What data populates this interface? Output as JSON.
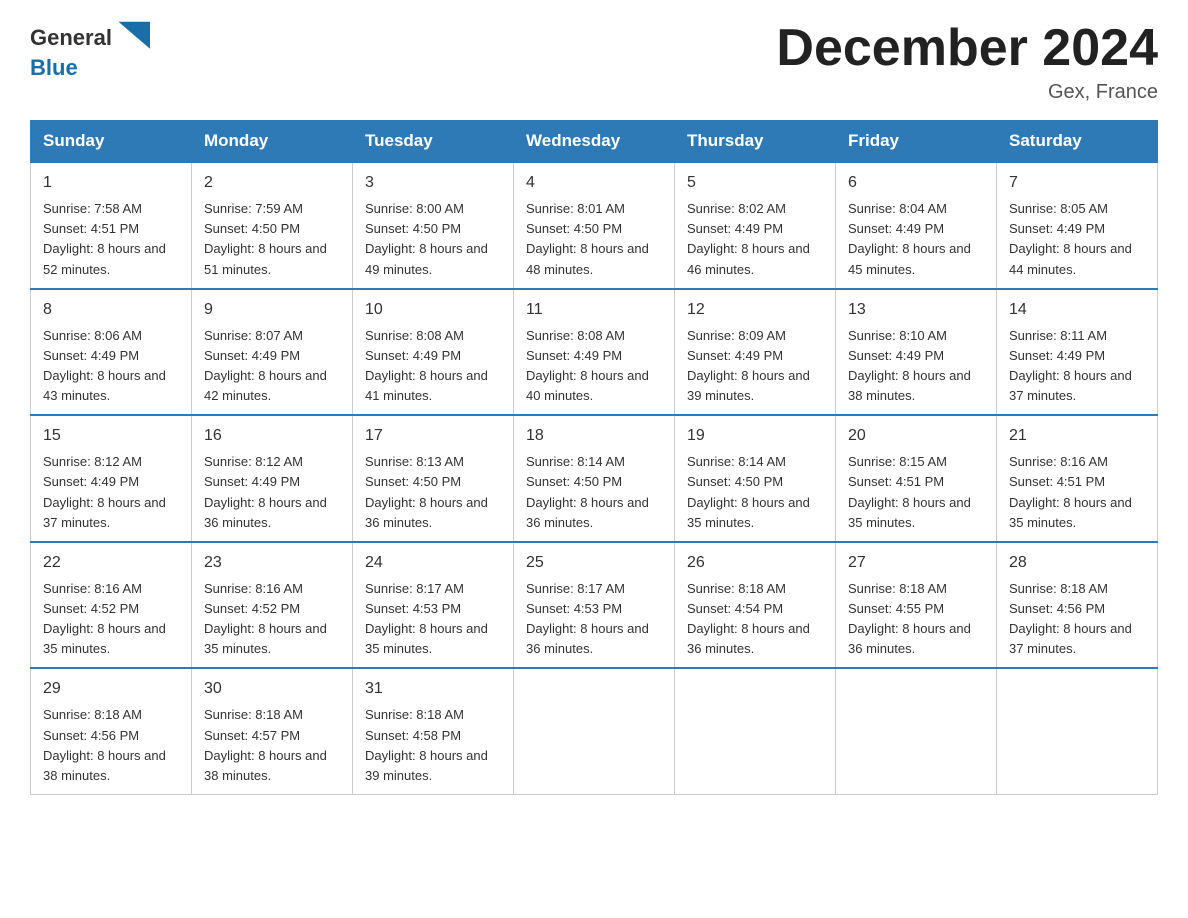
{
  "logo": {
    "text_general": "General",
    "text_blue": "Blue"
  },
  "header": {
    "month_title": "December 2024",
    "location": "Gex, France"
  },
  "weekdays": [
    "Sunday",
    "Monday",
    "Tuesday",
    "Wednesday",
    "Thursday",
    "Friday",
    "Saturday"
  ],
  "weeks": [
    [
      {
        "day": "1",
        "sunrise": "7:58 AM",
        "sunset": "4:51 PM",
        "daylight": "8 hours and 52 minutes."
      },
      {
        "day": "2",
        "sunrise": "7:59 AM",
        "sunset": "4:50 PM",
        "daylight": "8 hours and 51 minutes."
      },
      {
        "day": "3",
        "sunrise": "8:00 AM",
        "sunset": "4:50 PM",
        "daylight": "8 hours and 49 minutes."
      },
      {
        "day": "4",
        "sunrise": "8:01 AM",
        "sunset": "4:50 PM",
        "daylight": "8 hours and 48 minutes."
      },
      {
        "day": "5",
        "sunrise": "8:02 AM",
        "sunset": "4:49 PM",
        "daylight": "8 hours and 46 minutes."
      },
      {
        "day": "6",
        "sunrise": "8:04 AM",
        "sunset": "4:49 PM",
        "daylight": "8 hours and 45 minutes."
      },
      {
        "day": "7",
        "sunrise": "8:05 AM",
        "sunset": "4:49 PM",
        "daylight": "8 hours and 44 minutes."
      }
    ],
    [
      {
        "day": "8",
        "sunrise": "8:06 AM",
        "sunset": "4:49 PM",
        "daylight": "8 hours and 43 minutes."
      },
      {
        "day": "9",
        "sunrise": "8:07 AM",
        "sunset": "4:49 PM",
        "daylight": "8 hours and 42 minutes."
      },
      {
        "day": "10",
        "sunrise": "8:08 AM",
        "sunset": "4:49 PM",
        "daylight": "8 hours and 41 minutes."
      },
      {
        "day": "11",
        "sunrise": "8:08 AM",
        "sunset": "4:49 PM",
        "daylight": "8 hours and 40 minutes."
      },
      {
        "day": "12",
        "sunrise": "8:09 AM",
        "sunset": "4:49 PM",
        "daylight": "8 hours and 39 minutes."
      },
      {
        "day": "13",
        "sunrise": "8:10 AM",
        "sunset": "4:49 PM",
        "daylight": "8 hours and 38 minutes."
      },
      {
        "day": "14",
        "sunrise": "8:11 AM",
        "sunset": "4:49 PM",
        "daylight": "8 hours and 37 minutes."
      }
    ],
    [
      {
        "day": "15",
        "sunrise": "8:12 AM",
        "sunset": "4:49 PM",
        "daylight": "8 hours and 37 minutes."
      },
      {
        "day": "16",
        "sunrise": "8:12 AM",
        "sunset": "4:49 PM",
        "daylight": "8 hours and 36 minutes."
      },
      {
        "day": "17",
        "sunrise": "8:13 AM",
        "sunset": "4:50 PM",
        "daylight": "8 hours and 36 minutes."
      },
      {
        "day": "18",
        "sunrise": "8:14 AM",
        "sunset": "4:50 PM",
        "daylight": "8 hours and 36 minutes."
      },
      {
        "day": "19",
        "sunrise": "8:14 AM",
        "sunset": "4:50 PM",
        "daylight": "8 hours and 35 minutes."
      },
      {
        "day": "20",
        "sunrise": "8:15 AM",
        "sunset": "4:51 PM",
        "daylight": "8 hours and 35 minutes."
      },
      {
        "day": "21",
        "sunrise": "8:16 AM",
        "sunset": "4:51 PM",
        "daylight": "8 hours and 35 minutes."
      }
    ],
    [
      {
        "day": "22",
        "sunrise": "8:16 AM",
        "sunset": "4:52 PM",
        "daylight": "8 hours and 35 minutes."
      },
      {
        "day": "23",
        "sunrise": "8:16 AM",
        "sunset": "4:52 PM",
        "daylight": "8 hours and 35 minutes."
      },
      {
        "day": "24",
        "sunrise": "8:17 AM",
        "sunset": "4:53 PM",
        "daylight": "8 hours and 35 minutes."
      },
      {
        "day": "25",
        "sunrise": "8:17 AM",
        "sunset": "4:53 PM",
        "daylight": "8 hours and 36 minutes."
      },
      {
        "day": "26",
        "sunrise": "8:18 AM",
        "sunset": "4:54 PM",
        "daylight": "8 hours and 36 minutes."
      },
      {
        "day": "27",
        "sunrise": "8:18 AM",
        "sunset": "4:55 PM",
        "daylight": "8 hours and 36 minutes."
      },
      {
        "day": "28",
        "sunrise": "8:18 AM",
        "sunset": "4:56 PM",
        "daylight": "8 hours and 37 minutes."
      }
    ],
    [
      {
        "day": "29",
        "sunrise": "8:18 AM",
        "sunset": "4:56 PM",
        "daylight": "8 hours and 38 minutes."
      },
      {
        "day": "30",
        "sunrise": "8:18 AM",
        "sunset": "4:57 PM",
        "daylight": "8 hours and 38 minutes."
      },
      {
        "day": "31",
        "sunrise": "8:18 AM",
        "sunset": "4:58 PM",
        "daylight": "8 hours and 39 minutes."
      },
      null,
      null,
      null,
      null
    ]
  ]
}
